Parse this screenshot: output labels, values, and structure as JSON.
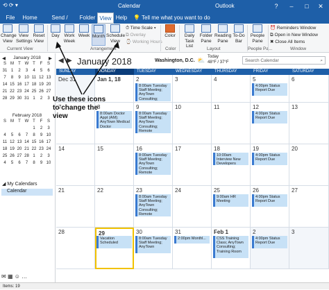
{
  "window": {
    "title": "Calendar",
    "app": "Outlook",
    "controls": [
      "?",
      "–",
      "□",
      "✕"
    ]
  },
  "menubar": {
    "tabs": [
      "File",
      "Home",
      "Send / Receive",
      "Folder",
      "View",
      "Help"
    ],
    "active": "View",
    "tell": "Tell me what you want to do"
  },
  "ribbon": {
    "current_view": {
      "label": "Current View",
      "change_view": "Change View",
      "view_settings": "View Settings",
      "reset_view": "Reset View"
    },
    "arrangement": {
      "label": "Arrangement",
      "day": "Day",
      "work_week": "Work Week",
      "week": "Week",
      "month": "Month",
      "schedule_view": "Schedule View",
      "time_scale": "Time Scale",
      "overlay": "Overlay",
      "working_hours": "Working Hours"
    },
    "color": {
      "label": "Color",
      "color": "Color"
    },
    "layout": {
      "label": "Layout",
      "daily_task_list": "Daily Task List",
      "folder_pane": "Folder Pane",
      "reading_pane": "Reading Pane",
      "todo_bar": "To-Do Bar"
    },
    "people": {
      "label": "People Pa...",
      "people_pane": "People Pane"
    },
    "window": {
      "label": "Window",
      "reminders": "Reminders Window",
      "open_new": "Open in New Window",
      "close_all": "Close All Items"
    }
  },
  "minical1": {
    "title": "January 2018",
    "headers": [
      "S",
      "M",
      "T",
      "W",
      "T",
      "F",
      "S"
    ],
    "rows": [
      [
        "31",
        "1",
        "2",
        "3",
        "4",
        "5",
        "6"
      ],
      [
        "7",
        "8",
        "9",
        "10",
        "11",
        "12",
        "13"
      ],
      [
        "14",
        "15",
        "16",
        "17",
        "18",
        "19",
        "20"
      ],
      [
        "21",
        "22",
        "23",
        "24",
        "25",
        "26",
        "27"
      ],
      [
        "28",
        "29",
        "30",
        "31",
        "1",
        "2",
        "3"
      ]
    ]
  },
  "minical2": {
    "title": "February 2018",
    "headers": [
      "S",
      "M",
      "T",
      "W",
      "T",
      "F",
      "S"
    ],
    "rows": [
      [
        "1",
        "2",
        "3"
      ],
      [
        "4",
        "5",
        "6",
        "7",
        "8",
        "9",
        "10"
      ],
      [
        "11",
        "12",
        "13",
        "14",
        "15",
        "16",
        "17"
      ],
      [
        "18",
        "19",
        "20",
        "21",
        "22",
        "23",
        "24"
      ],
      [
        "25",
        "26",
        "27",
        "28",
        "1",
        "2",
        "3"
      ],
      [
        "4",
        "5",
        "6",
        "7",
        "8",
        "9",
        "10"
      ]
    ]
  },
  "folders": {
    "my_calendars": "My Calendars",
    "calendar": "Calendar"
  },
  "calendar": {
    "month": "January 2018",
    "location": "Washington, D.C.",
    "weather": {
      "label": "Today",
      "temp": "48°F / 37°F"
    },
    "search_placeholder": "Search Calendar",
    "days": [
      "SUNDAY",
      "MONDAY",
      "TUESDAY",
      "WEDNESDAY",
      "THURSDAY",
      "FRIDAY",
      "SATURDAY"
    ],
    "weeks": [
      [
        "Dec 31",
        "Jan 1, 18",
        "2",
        "3",
        "4",
        "5",
        "6"
      ],
      [
        "7",
        "8",
        "9",
        "10",
        "11",
        "12",
        "13"
      ],
      [
        "14",
        "15",
        "16",
        "17",
        "18",
        "19",
        "20"
      ],
      [
        "21",
        "22",
        "23",
        "24",
        "25",
        "26",
        "27"
      ],
      [
        "28",
        "29",
        "30",
        "31",
        "Feb 1",
        "2",
        "3"
      ]
    ],
    "appts": {
      "w0_tue": "8:00am Tuesday Staff Meeting; AnyTown Consulting; Remote",
      "w0_fri": "4:00pm Status Report Due",
      "w1_mon": "8:00am Doctor Appt (AM); AnyTown Medical Doctor",
      "w1_tue": "8:00am Tuesday Staff Meeting; AnyTown Consulting; Remote",
      "w1_fri": "4:00pm Status Report Due",
      "w2_tue": "8:00am Tuesday Staff Meeting; AnyTown Consulting; Remote",
      "w2_thu": "10:00am Interview New Developers",
      "w2_fri": "4:00pm Status Report Due",
      "w3_tue": "8:00am Tuesday Staff Meeting; AnyTown Consulting; Remote",
      "w3_thu": "9:00am HR Meeting",
      "w3_fri": "4:00pm Status Report Due",
      "w4_mon": "Vacation Scheduled",
      "w4_tue": "8:00am Tuesday Staff Meeting; AnyTown",
      "w4_wed": "2:00pm Monthl...",
      "w4_thu": "CSS Training Class; AnyTown Consulting; Training Room",
      "w4_fri": "4:00pm Status Report Due"
    }
  },
  "annotation": "Use these icons to change the view",
  "statusbar": {
    "items": "Items: 19"
  }
}
